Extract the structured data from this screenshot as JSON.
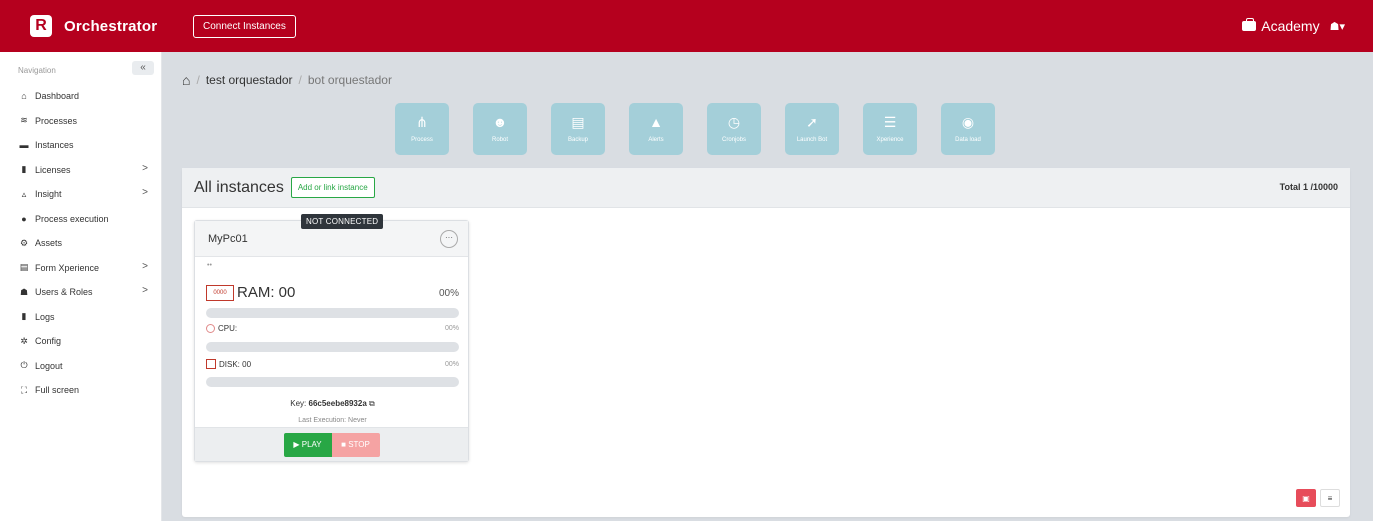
{
  "topbar": {
    "brand": "Orchestrator",
    "logo_letter": "R",
    "connect_label": "Connect Instances",
    "workspace": "Academy",
    "user_caret": "▾"
  },
  "sidebar": {
    "heading": "Navigation",
    "collapse": "«",
    "items": [
      {
        "label": "Dashboard",
        "icon": "home-icon",
        "glyph": "⌂",
        "chevron": ""
      },
      {
        "label": "Processes",
        "icon": "layers-icon",
        "glyph": "≋",
        "chevron": ""
      },
      {
        "label": "Instances",
        "icon": "server-icon",
        "glyph": "▬",
        "chevron": ""
      },
      {
        "label": "Licenses",
        "icon": "file-icon",
        "glyph": "▮",
        "chevron": ">"
      },
      {
        "label": "Insight",
        "icon": "chart-icon",
        "glyph": "▵",
        "chevron": ">"
      },
      {
        "label": "Process execution",
        "icon": "gauge-icon",
        "glyph": "●",
        "chevron": ""
      },
      {
        "label": "Assets",
        "icon": "cogs-icon",
        "glyph": "⚙",
        "chevron": ""
      },
      {
        "label": "Form Xperience",
        "icon": "form-icon",
        "glyph": "▤",
        "chevron": ">"
      },
      {
        "label": "Users & Roles",
        "icon": "users-icon",
        "glyph": "☗",
        "chevron": ">"
      },
      {
        "label": "Logs",
        "icon": "file-icon",
        "glyph": "▮",
        "chevron": ""
      },
      {
        "label": "Config",
        "icon": "gear-icon",
        "glyph": "✲",
        "chevron": ""
      },
      {
        "label": "Logout",
        "icon": "power-icon",
        "glyph": "⏻",
        "chevron": ""
      },
      {
        "label": "Full screen",
        "icon": "expand-icon",
        "glyph": "⛶",
        "chevron": ""
      }
    ]
  },
  "breadcrumb": {
    "home_glyph": "⌂",
    "sep": "/",
    "items": [
      "test orquestador",
      "bot orquestador"
    ]
  },
  "tiles": [
    {
      "label": "Process",
      "glyph": "⋔",
      "icon": "process-icon"
    },
    {
      "label": "Robot",
      "glyph": "☻",
      "icon": "robot-icon"
    },
    {
      "label": "Backup",
      "glyph": "▤",
      "icon": "backup-icon"
    },
    {
      "label": "Alerts",
      "glyph": "▲",
      "icon": "alert-icon"
    },
    {
      "label": "Cronjobs",
      "glyph": "◷",
      "icon": "clock-icon"
    },
    {
      "label": "Launch Bot",
      "glyph": "➚",
      "icon": "rocket-icon"
    },
    {
      "label": "Xperience",
      "glyph": "☰",
      "icon": "list-icon"
    },
    {
      "label": "Data load",
      "glyph": "◉",
      "icon": "database-icon"
    }
  ],
  "panel": {
    "title": "All instances",
    "add_label": "Add or link instance",
    "total": "Total 1 /10000"
  },
  "instance": {
    "status": "NOT CONNECTED",
    "name": "MyPc01",
    "more": "···",
    "dots": "••",
    "ram_label": "RAM: 00",
    "ram_icon_text": "0000",
    "ram_pct": "00%",
    "ram_fill": 0,
    "cpu_label": "CPU:",
    "cpu_pct": "00%",
    "cpu_fill": 0,
    "disk_label": "DISK: 00",
    "disk_pct": "00%",
    "disk_fill": 0,
    "key_prefix": "Key: ",
    "key": "66c5eebe8932a",
    "copy_glyph": "⧉",
    "last_execution": "Last Execution: Never",
    "play_label": "▶ PLAY",
    "stop_label": "■ STOP"
  },
  "view_toggle": {
    "card_glyph": "▣",
    "list_glyph": "≡"
  },
  "colors": {
    "brand": "#b5001e",
    "tile": "#a4cfd9",
    "play": "#28a745",
    "stop": "#f5a3a3"
  }
}
